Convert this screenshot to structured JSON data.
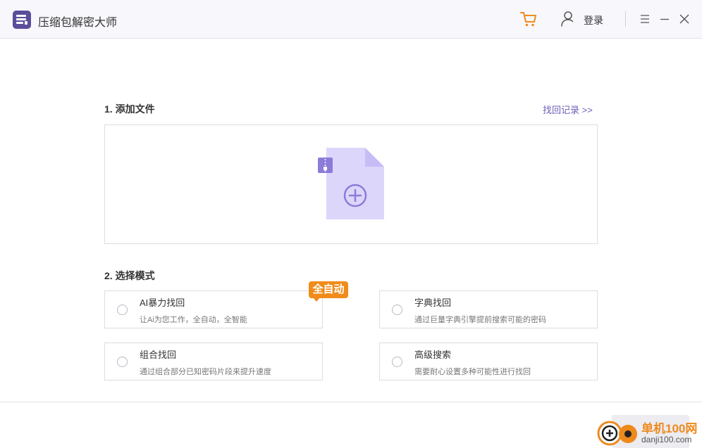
{
  "app": {
    "title": "压缩包解密大师",
    "login_label": "登录"
  },
  "theme": {
    "accent": "#6b5fb5",
    "brand": "#5b4d9a",
    "cart": "#f08c1a",
    "file_icon": "#ddd6fb"
  },
  "icons": [
    "app-logo-icon",
    "cart-icon",
    "user-icon",
    "menu-icon",
    "minimize-icon",
    "close-icon",
    "zip-file-add-icon",
    "plus-circle-icon"
  ],
  "step1": {
    "label": "1. 添加文件",
    "history_link": "找回记录 >>"
  },
  "step2": {
    "label": "2. 选择模式",
    "badge": "全自动",
    "modes": [
      {
        "title": "AI暴力找回",
        "desc": "让Ai为您工作，全自动，全智能"
      },
      {
        "title": "字典找回",
        "desc": "通过巨量字典引擎提前搜索可能的密码"
      },
      {
        "title": "组合找回",
        "desc": "通过组合部分已知密码片段来提升速度"
      },
      {
        "title": "高级搜索",
        "desc": "需要耐心设置多种可能性进行找回"
      }
    ]
  },
  "watermark": {
    "line1": "单机100网",
    "line2": "danji100.com"
  }
}
